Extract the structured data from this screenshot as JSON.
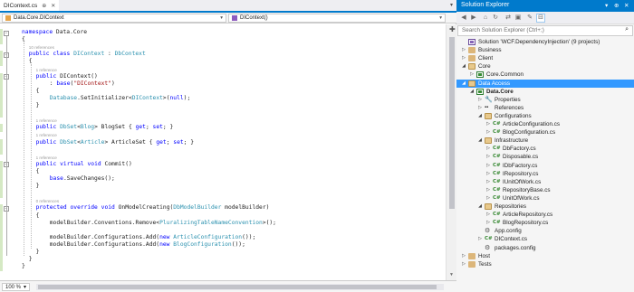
{
  "editor": {
    "tab": {
      "title": "DIContext.cs",
      "pin": "⊕",
      "close": "✕"
    },
    "nav": {
      "left": "Data.Core.DIContext",
      "right": "DIContext()"
    },
    "zoom": "100 %",
    "lines": [
      {
        "kind": "code",
        "fold": "−",
        "tokens": [
          [
            "kw",
            "namespace"
          ],
          [
            "p",
            " Data.Core"
          ]
        ]
      },
      {
        "kind": "code",
        "tokens": [
          [
            "p",
            "{"
          ]
        ]
      },
      {
        "kind": "lens",
        "text": "10 references"
      },
      {
        "kind": "code",
        "fold": "−",
        "tokens": [
          [
            "kw",
            "public"
          ],
          [
            "p",
            " "
          ],
          [
            "kw",
            "class"
          ],
          [
            "p",
            " "
          ],
          [
            "ty",
            "DIContext"
          ],
          [
            "p",
            " : "
          ],
          [
            "ty",
            "DbContext"
          ]
        ]
      },
      {
        "kind": "code",
        "tokens": [
          [
            "p",
            "{"
          ]
        ]
      },
      {
        "kind": "lens",
        "text": "1 reference"
      },
      {
        "kind": "code",
        "fold": "−",
        "tokens": [
          [
            "kw",
            "public"
          ],
          [
            "p",
            " DIContext()"
          ]
        ]
      },
      {
        "kind": "code",
        "tokens": [
          [
            "p",
            "    : "
          ],
          [
            "kw",
            "base"
          ],
          [
            "p",
            "("
          ],
          [
            "st",
            "\"DIContext\""
          ],
          [
            "p",
            ")"
          ]
        ]
      },
      {
        "kind": "code",
        "tokens": [
          [
            "p",
            "{"
          ]
        ]
      },
      {
        "kind": "code",
        "tokens": [
          [
            "p",
            "    "
          ],
          [
            "ty",
            "Database"
          ],
          [
            "p",
            ".SetInitializer<"
          ],
          [
            "ty",
            "DIContext"
          ],
          [
            "p",
            ">("
          ],
          [
            "kw",
            "null"
          ],
          [
            "p",
            ");"
          ]
        ]
      },
      {
        "kind": "code",
        "tokens": [
          [
            "p",
            "}"
          ]
        ]
      },
      {
        "kind": "blank"
      },
      {
        "kind": "lens",
        "text": "1 reference"
      },
      {
        "kind": "code",
        "tokens": [
          [
            "kw",
            "public"
          ],
          [
            "p",
            " "
          ],
          [
            "ty",
            "DbSet"
          ],
          [
            "p",
            "<"
          ],
          [
            "ty",
            "Blog"
          ],
          [
            "p",
            "> BlogSet { "
          ],
          [
            "kw",
            "get"
          ],
          [
            "p",
            "; "
          ],
          [
            "kw",
            "set"
          ],
          [
            "p",
            "; }"
          ]
        ]
      },
      {
        "kind": "lens",
        "text": "1 reference"
      },
      {
        "kind": "code",
        "tokens": [
          [
            "kw",
            "public"
          ],
          [
            "p",
            " "
          ],
          [
            "ty",
            "DbSet"
          ],
          [
            "p",
            "<"
          ],
          [
            "ty",
            "Article"
          ],
          [
            "p",
            "> ArticleSet { "
          ],
          [
            "kw",
            "get"
          ],
          [
            "p",
            "; "
          ],
          [
            "kw",
            "set"
          ],
          [
            "p",
            "; }"
          ]
        ]
      },
      {
        "kind": "blank"
      },
      {
        "kind": "lens",
        "text": "1 reference"
      },
      {
        "kind": "code",
        "fold": "−",
        "tokens": [
          [
            "kw",
            "public"
          ],
          [
            "p",
            " "
          ],
          [
            "kw",
            "virtual"
          ],
          [
            "p",
            " "
          ],
          [
            "kw",
            "void"
          ],
          [
            "p",
            " Commit()"
          ]
        ]
      },
      {
        "kind": "code",
        "tokens": [
          [
            "p",
            "{"
          ]
        ]
      },
      {
        "kind": "code",
        "tokens": [
          [
            "p",
            "    "
          ],
          [
            "kw",
            "base"
          ],
          [
            "p",
            ".SaveChanges();"
          ]
        ]
      },
      {
        "kind": "code",
        "tokens": [
          [
            "p",
            "}"
          ]
        ]
      },
      {
        "kind": "blank"
      },
      {
        "kind": "lens",
        "text": "0 references"
      },
      {
        "kind": "code",
        "fold": "−",
        "tokens": [
          [
            "kw",
            "protected"
          ],
          [
            "p",
            " "
          ],
          [
            "kw",
            "override"
          ],
          [
            "p",
            " "
          ],
          [
            "kw",
            "void"
          ],
          [
            "p",
            " OnModelCreating("
          ],
          [
            "ty",
            "DbModelBuilder"
          ],
          [
            "p",
            " modelBuilder)"
          ]
        ]
      },
      {
        "kind": "code",
        "tokens": [
          [
            "p",
            "{"
          ]
        ]
      },
      {
        "kind": "code",
        "tokens": [
          [
            "p",
            "    modelBuilder.Conventions.Remove<"
          ],
          [
            "ty",
            "PluralizingTableNameConvention"
          ],
          [
            "p",
            ">();"
          ]
        ]
      },
      {
        "kind": "blank"
      },
      {
        "kind": "code",
        "tokens": [
          [
            "p",
            "    modelBuilder.Configurations.Add("
          ],
          [
            "kw",
            "new"
          ],
          [
            "p",
            " "
          ],
          [
            "ty",
            "ArticleConfiguration"
          ],
          [
            "p",
            "());"
          ]
        ]
      },
      {
        "kind": "code",
        "tokens": [
          [
            "p",
            "    modelBuilder.Configurations.Add("
          ],
          [
            "kw",
            "new"
          ],
          [
            "p",
            " "
          ],
          [
            "ty",
            "BlogConfiguration"
          ],
          [
            "p",
            "());"
          ]
        ]
      },
      {
        "kind": "code",
        "tokens": [
          [
            "p",
            "}"
          ]
        ]
      },
      {
        "kind": "code",
        "tokens": [
          [
            "p",
            "}"
          ]
        ]
      },
      {
        "kind": "code",
        "tokens": [
          [
            "p",
            "}"
          ]
        ]
      }
    ]
  },
  "solution_explorer": {
    "title": "Solution Explorer",
    "search_placeholder": "Search Solution Explorer (Ctrl+;)",
    "items": [
      {
        "label": "Solution 'WCF.DependencyInjection' (9 projects)",
        "icon": "solution-icon",
        "arrow": ""
      },
      {
        "label": "Business",
        "icon": "folder-icon",
        "arrow": "▷"
      },
      {
        "label": "Client",
        "icon": "folder-icon",
        "arrow": "▷"
      },
      {
        "label": "Core",
        "icon": "folder-open-icon",
        "arrow": "◢"
      },
      {
        "label": "Core.Common",
        "icon": "csharp-project-icon",
        "arrow": "▷"
      },
      {
        "label": "Data Access",
        "icon": "folder-open-icon",
        "arrow": "◢",
        "selected": true
      },
      {
        "label": "Data.Core",
        "icon": "csharp-project-icon",
        "arrow": "◢",
        "bold": true
      },
      {
        "label": "Properties",
        "icon": "wrench-icon",
        "arrow": "▷"
      },
      {
        "label": "References",
        "icon": "references-icon",
        "arrow": "▷"
      },
      {
        "label": "Configurations",
        "icon": "folder-open-icon",
        "arrow": "◢"
      },
      {
        "label": "ArticleConfiguration.cs",
        "icon": "csharp-file-icon",
        "arrow": "▷"
      },
      {
        "label": "BlogConfiguration.cs",
        "icon": "csharp-file-icon",
        "arrow": "▷"
      },
      {
        "label": "Infrastructure",
        "icon": "folder-open-icon",
        "arrow": "◢"
      },
      {
        "label": "DbFactory.cs",
        "icon": "csharp-file-icon",
        "arrow": "▷"
      },
      {
        "label": "Disposable.cs",
        "icon": "csharp-file-icon",
        "arrow": "▷"
      },
      {
        "label": "IDbFactory.cs",
        "icon": "csharp-file-icon",
        "arrow": "▷"
      },
      {
        "label": "IRepository.cs",
        "icon": "csharp-file-icon",
        "arrow": "▷"
      },
      {
        "label": "IUnitOfWork.cs",
        "icon": "csharp-file-icon",
        "arrow": "▷"
      },
      {
        "label": "RepositoryBase.cs",
        "icon": "csharp-file-icon",
        "arrow": "▷"
      },
      {
        "label": "UnitOfWork.cs",
        "icon": "csharp-file-icon",
        "arrow": "▷"
      },
      {
        "label": "Repositories",
        "icon": "folder-open-icon",
        "arrow": "◢"
      },
      {
        "label": "ArticleRepository.cs",
        "icon": "csharp-file-icon",
        "arrow": "▷"
      },
      {
        "label": "BlogRepository.cs",
        "icon": "csharp-file-icon",
        "arrow": "▷"
      },
      {
        "label": "App.config",
        "icon": "config-icon",
        "arrow": ""
      },
      {
        "label": "DIContext.cs",
        "icon": "csharp-file-icon",
        "arrow": "▷"
      },
      {
        "label": "packages.config",
        "icon": "config-icon",
        "arrow": ""
      },
      {
        "label": "Host",
        "icon": "folder-icon",
        "arrow": "▷"
      },
      {
        "label": "Tests",
        "icon": "folder-icon",
        "arrow": "▷"
      }
    ]
  },
  "colors": {
    "accent": "#007acc",
    "selection": "#3399ff",
    "keyword": "#0000ff",
    "type": "#2b91af",
    "string": "#a31515"
  }
}
